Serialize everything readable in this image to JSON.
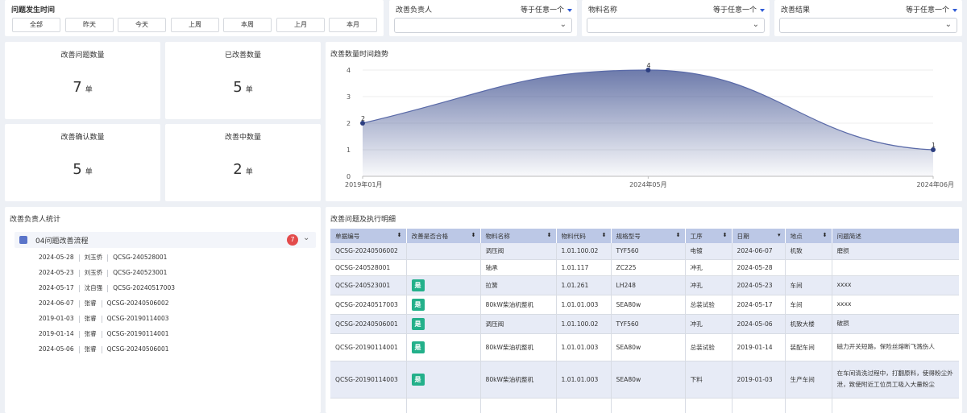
{
  "time_filter": {
    "title": "问题发生时间",
    "buttons": [
      "全部",
      "昨天",
      "今天",
      "上周",
      "本周",
      "上月",
      "本月"
    ]
  },
  "filters": [
    {
      "label": "改善负责人",
      "op": "等于任意一个"
    },
    {
      "label": "物料名称",
      "op": "等于任意一个"
    },
    {
      "label": "改善结果",
      "op": "等于任意一个"
    }
  ],
  "kpis": [
    {
      "title": "改善问题数量",
      "value": "7",
      "unit": "单"
    },
    {
      "title": "已改善数量",
      "value": "5",
      "unit": "单"
    },
    {
      "title": "改善确认数量",
      "value": "5",
      "unit": "单"
    },
    {
      "title": "改善中数量",
      "value": "2",
      "unit": "单"
    }
  ],
  "trend": {
    "title": "改善数量时间趋势",
    "chart_data": {
      "type": "area",
      "categories": [
        "2019年01月",
        "2024年05月",
        "2024年06月"
      ],
      "values": [
        2,
        4,
        1
      ],
      "ylim": [
        0,
        4
      ],
      "yticks": [
        "0",
        "1",
        "2",
        "3",
        "4"
      ],
      "color": "#3d4f8f"
    }
  },
  "owners": {
    "title": "改善负责人统计",
    "group": {
      "label": "04问题改善流程",
      "count": "7"
    },
    "rows": [
      {
        "date": "2024-05-28",
        "name": "刘玉侨",
        "code": "QCSG-240528001"
      },
      {
        "date": "2024-05-23",
        "name": "刘玉侨",
        "code": "QCSG-240523001"
      },
      {
        "date": "2024-05-17",
        "name": "沈自强",
        "code": "QCSG-20240517003"
      },
      {
        "date": "2024-06-07",
        "name": "张睿",
        "code": "QCSG-20240506002"
      },
      {
        "date": "2019-01-03",
        "name": "张睿",
        "code": "QCSG-20190114003"
      },
      {
        "date": "2019-01-14",
        "name": "张睿",
        "code": "QCSG-20190114001"
      },
      {
        "date": "2024-05-06",
        "name": "张睿",
        "code": "QCSG-20240506001"
      }
    ]
  },
  "detail": {
    "title": "改善问题及执行明细",
    "columns": [
      "单据编号",
      "改善是否合格",
      "物料名称",
      "物料代码",
      "规格型号",
      "工序",
      "日期",
      "地点",
      "问题简述"
    ],
    "rows": [
      [
        "QCSG-20240506002",
        "",
        "调压阀",
        "1.01.100.02",
        "TYF560",
        "电镀",
        "2024-06-07",
        "机致",
        "磨损"
      ],
      [
        "QCSG-240528001",
        "",
        "轴承",
        "1.01.117",
        "ZC225",
        "冲孔",
        "2024-05-28",
        "",
        ""
      ],
      [
        "QCSG-240523001",
        "是",
        "拉簧",
        "1.01.261",
        "LH248",
        "冲孔",
        "2024-05-23",
        "车间",
        "xxxx"
      ],
      [
        "QCSG-20240517003",
        "是",
        "80kW柴油机整机",
        "1.01.01.003",
        "SEA80w",
        "总装试验",
        "2024-05-17",
        "车间",
        "xxxx"
      ],
      [
        "QCSG-20240506001",
        "是",
        "调压阀",
        "1.01.100.02",
        "TYF560",
        "冲孔",
        "2024-05-06",
        "机致大楼",
        "破损"
      ],
      [
        "QCSG-20190114001",
        "是",
        "80kW柴油机整机",
        "1.01.01.003",
        "SEA80w",
        "总装试验",
        "2019-01-14",
        "装配车间",
        "磁力开关短路，保险丝熔断飞溅伤人"
      ],
      [
        "QCSG-20190114003",
        "是",
        "80kW柴油机整机",
        "1.01.01.003",
        "SEA80w",
        "下料",
        "2019-01-03",
        "生产车间",
        "在车间清洗过程中，打翻原料，使得粉尘外泄，致使附近工位员工吸入大量粉尘"
      ]
    ]
  }
}
